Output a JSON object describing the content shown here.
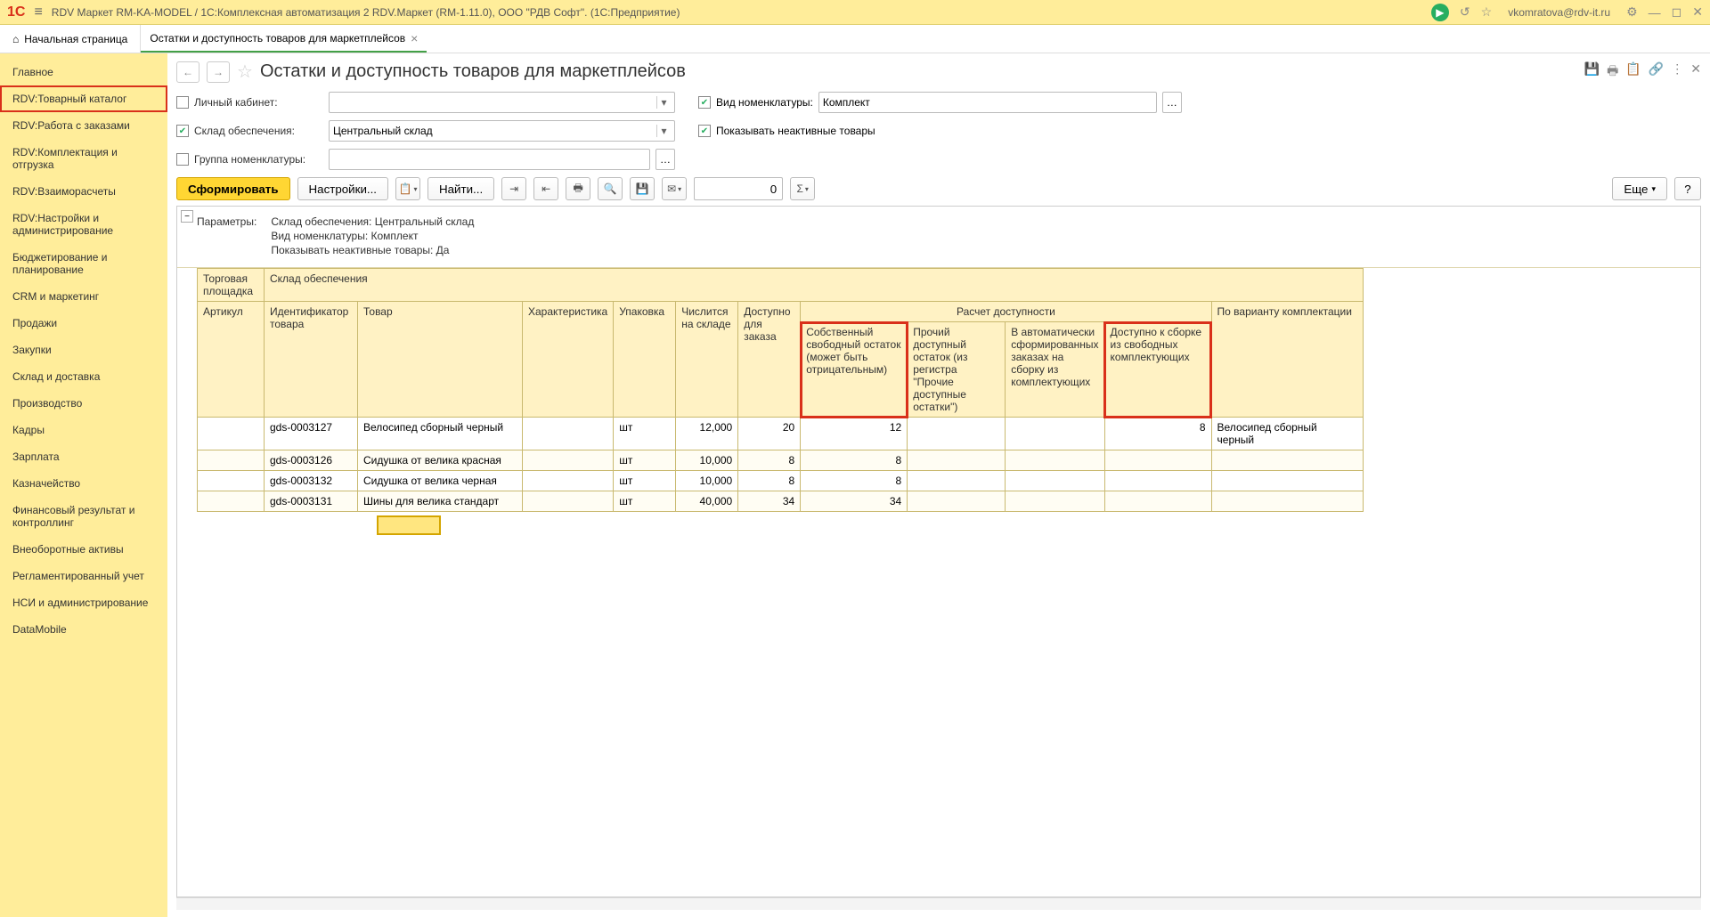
{
  "titlebar": {
    "logo": "1C",
    "title": "RDV Маркет RM-KA-MODEL / 1С:Комплексная автоматизация 2 RDV.Маркет (RM-1.11.0), ООО \"РДВ Софт\". (1С:Предприятие)",
    "user": "vkomratova@rdv-it.ru"
  },
  "tabs": {
    "home": "Начальная страница",
    "active": "Остатки и доступность товаров для маркетплейсов"
  },
  "sidebar": {
    "items": [
      "Главное",
      "RDV:Товарный каталог",
      "RDV:Работа с заказами",
      "RDV:Комплектация и отгрузка",
      "RDV:Взаиморасчеты",
      "RDV:Настройки и администрирование",
      "Бюджетирование и планирование",
      "CRM и маркетинг",
      "Продажи",
      "Закупки",
      "Склад и доставка",
      "Производство",
      "Кадры",
      "Зарплата",
      "Казначейство",
      "Финансовый результат и контроллинг",
      "Внеоборотные активы",
      "Регламентированный учет",
      "НСИ и администрирование",
      "DataMobile"
    ],
    "highlightedIndex": 1
  },
  "page": {
    "title": "Остатки и доступность товаров для маркетплейсов"
  },
  "filters": {
    "personalCabinetLabel": "Личный кабинет:",
    "personalCabinetChecked": false,
    "personalCabinetValue": "",
    "nomenTypeLabel": "Вид номенклатуры:",
    "nomenTypeChecked": true,
    "nomenTypeValue": "Комплект",
    "warehouseLabel": "Склад обеспечения:",
    "warehouseChecked": true,
    "warehouseValue": "Центральный склад",
    "showInactiveLabel": "Показывать неактивные товары",
    "showInactiveChecked": true,
    "nomenGroupLabel": "Группа номенклатуры:",
    "nomenGroupChecked": false,
    "nomenGroupValue": ""
  },
  "toolbar": {
    "generate": "Сформировать",
    "settings": "Настройки...",
    "find": "Найти...",
    "numValue": "0",
    "more": "Еще",
    "help": "?"
  },
  "params": {
    "label": "Параметры:",
    "lines": [
      "Склад обеспечения: Центральный склад",
      "Вид номенклатуры: Комплект",
      "Показывать неактивные товары: Да"
    ]
  },
  "columns": {
    "marketplace": "Торговая площадка",
    "warehouse": "Склад обеспечения",
    "article": "Артикул",
    "productId": "Идентификатор товара",
    "product": "Товар",
    "characteristic": "Характеристика",
    "packaging": "Упаковка",
    "inStock": "Числится на складе",
    "available": "Доступно для заказа",
    "availabilityCalc": "Расчет доступности",
    "ownFree": "Собственный свободный остаток (может быть отрицательным)",
    "otherAvail": "Прочий доступный остаток (из регистра \"Прочие доступные остатки\")",
    "inAuto": "В автоматически сформированных заказах на сборку из комплектующих",
    "availAssembly": "Доступно к сборке из свободных комплектующих",
    "byVariant": "По варианту комплектации"
  },
  "chart_data": {
    "type": "table",
    "columns": [
      "Идентификатор товара",
      "Товар",
      "Упаковка",
      "Числится на складе",
      "Доступно для заказа",
      "Собственный свободный остаток",
      "Доступно к сборке",
      "По варианту комплектации"
    ],
    "rows": [
      {
        "productId": "gds-0003127",
        "product": "Велосипед сборный черный",
        "packaging": "шт",
        "inStock": "12,000",
        "available": "20",
        "ownFree": "12",
        "availAssembly": "8",
        "byVariant": "Велосипед сборный черный"
      },
      {
        "productId": "gds-0003126",
        "product": "Сидушка от велика красная",
        "packaging": "шт",
        "inStock": "10,000",
        "available": "8",
        "ownFree": "8",
        "availAssembly": "",
        "byVariant": ""
      },
      {
        "productId": "gds-0003132",
        "product": "Сидушка от велика черная",
        "packaging": "шт",
        "inStock": "10,000",
        "available": "8",
        "ownFree": "8",
        "availAssembly": "",
        "byVariant": ""
      },
      {
        "productId": "gds-0003131",
        "product": "Шины для велика стандарт",
        "packaging": "шт",
        "inStock": "40,000",
        "available": "34",
        "ownFree": "34",
        "availAssembly": "",
        "byVariant": ""
      }
    ]
  }
}
